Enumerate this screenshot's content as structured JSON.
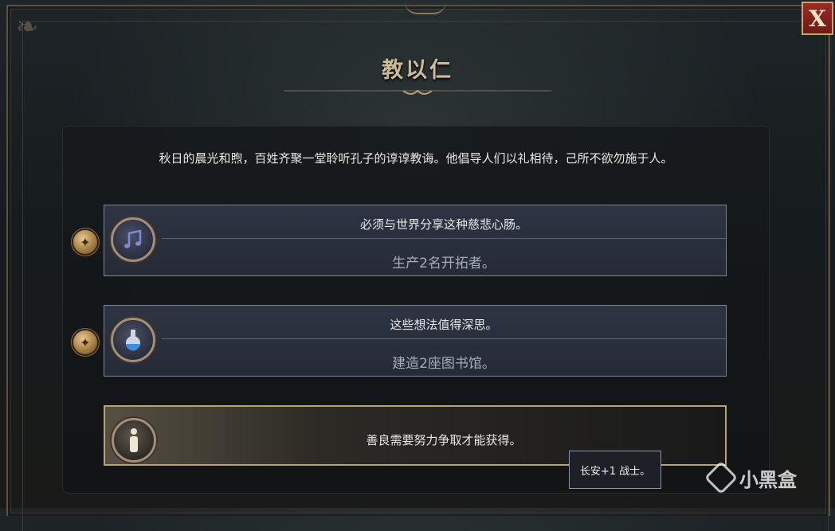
{
  "dialog": {
    "title": "教以仁",
    "close_label": "X",
    "description": "秋日的晨光和煦，百姓齐聚一堂聆听孔子的谆谆教诲。他倡导人们以礼相待，己所不欲勿施于人。"
  },
  "choices": [
    {
      "prompt": "必须与世界分享这种慈悲心肠。",
      "effect": "生产2名开拓者。",
      "icon": "music-note-icon",
      "has_reward_badge": true
    },
    {
      "prompt": "这些想法值得深思。",
      "effect": "建造2座图书馆。",
      "icon": "flask-icon",
      "has_reward_badge": true
    },
    {
      "prompt": "善良需要努力争取才能获得。",
      "effect": "",
      "icon": "person-icon",
      "has_reward_badge": false
    }
  ],
  "tooltip": {
    "text": "长安+1 战士。"
  },
  "watermark": {
    "text": "小黑盒"
  },
  "colors": {
    "title": "#cdbb98",
    "choice_border": "#7b8596",
    "selected_border": "#b6a37b",
    "close_button": "#9a2b26"
  }
}
